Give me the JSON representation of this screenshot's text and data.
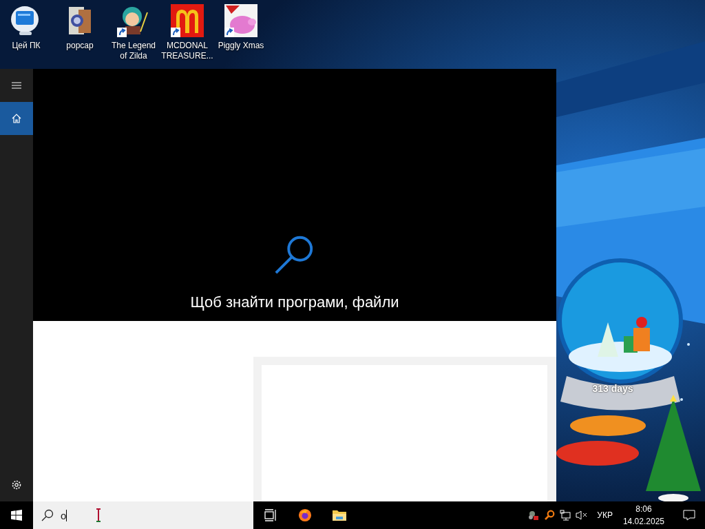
{
  "desktop_icons": [
    {
      "label": "Цей ПК",
      "kind": "computer",
      "shortcut": false
    },
    {
      "label": "popcap",
      "kind": "folder",
      "shortcut": false
    },
    {
      "label": "The Legend of Zilda",
      "kind": "game",
      "shortcut": true
    },
    {
      "label": "MCDONAL TREASURE...",
      "kind": "arches",
      "shortcut": true
    },
    {
      "label": "Piggly Xmas",
      "kind": "pig",
      "shortcut": true
    }
  ],
  "start_menu": {
    "rail": [
      {
        "kind": "menu",
        "selected": false
      },
      {
        "kind": "home",
        "selected": true
      }
    ],
    "rail_bottom": [
      {
        "kind": "settings",
        "selected": false
      }
    ],
    "search_hint": "Щоб знайти програми, файли"
  },
  "gadget": {
    "label": "313 days"
  },
  "taskbar": {
    "search": {
      "value": "o"
    },
    "apps": [
      {
        "kind": "task-view"
      },
      {
        "kind": "firefox"
      },
      {
        "kind": "explorer"
      }
    ],
    "tray": {
      "icons": [
        {
          "kind": "app"
        },
        {
          "kind": "search"
        },
        {
          "kind": "network"
        },
        {
          "kind": "volume",
          "muted": true
        }
      ],
      "language": "УКР",
      "time": "8:06",
      "date": "14.02.2025"
    }
  }
}
